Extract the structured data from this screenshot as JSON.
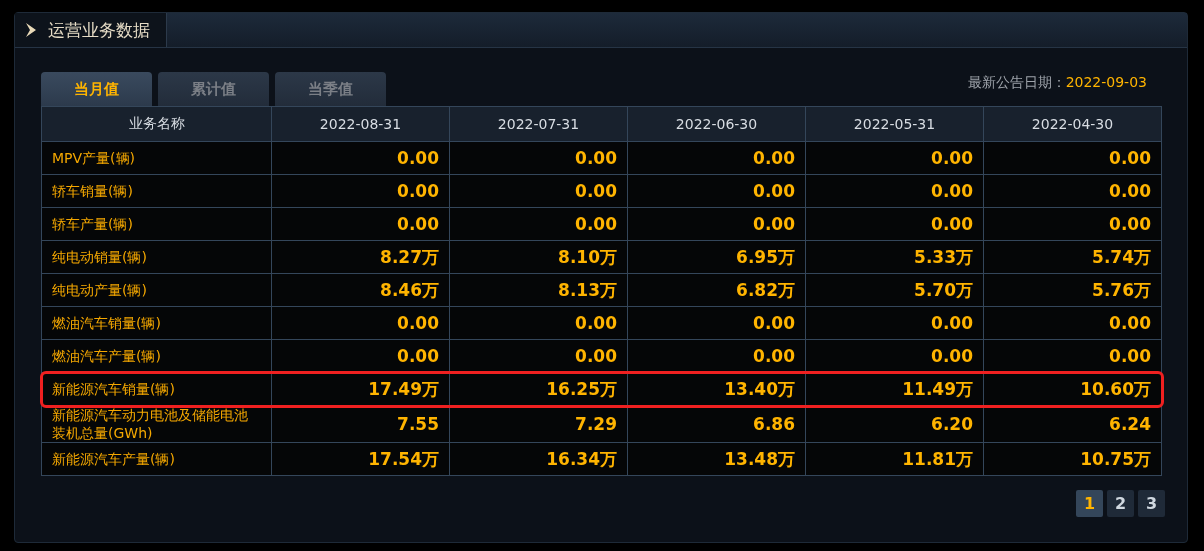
{
  "panel": {
    "title": "运营业务数据"
  },
  "tabs": [
    {
      "label": "当月值",
      "selected": true
    },
    {
      "label": "累计值",
      "selected": false
    },
    {
      "label": "当季值",
      "selected": false
    }
  ],
  "announcement": {
    "label": "最新公告日期：",
    "date": "2022-09-03"
  },
  "table": {
    "columns": [
      "业务名称",
      "2022-08-31",
      "2022-07-31",
      "2022-06-30",
      "2022-05-31",
      "2022-04-30"
    ],
    "rows": [
      {
        "name": "MPV产量(辆)",
        "highlighted": false,
        "values": [
          "0.00",
          "0.00",
          "0.00",
          "0.00",
          "0.00"
        ]
      },
      {
        "name": "轿车销量(辆)",
        "highlighted": false,
        "values": [
          "0.00",
          "0.00",
          "0.00",
          "0.00",
          "0.00"
        ]
      },
      {
        "name": "轿车产量(辆)",
        "highlighted": false,
        "values": [
          "0.00",
          "0.00",
          "0.00",
          "0.00",
          "0.00"
        ]
      },
      {
        "name": "纯电动销量(辆)",
        "highlighted": false,
        "values": [
          "8.27万",
          "8.10万",
          "6.95万",
          "5.33万",
          "5.74万"
        ]
      },
      {
        "name": "纯电动产量(辆)",
        "highlighted": false,
        "values": [
          "8.46万",
          "8.13万",
          "6.82万",
          "5.70万",
          "5.76万"
        ]
      },
      {
        "name": "燃油汽车销量(辆)",
        "highlighted": false,
        "values": [
          "0.00",
          "0.00",
          "0.00",
          "0.00",
          "0.00"
        ]
      },
      {
        "name": "燃油汽车产量(辆)",
        "highlighted": false,
        "values": [
          "0.00",
          "0.00",
          "0.00",
          "0.00",
          "0.00"
        ]
      },
      {
        "name": "新能源汽车销量(辆)",
        "highlighted": true,
        "values": [
          "17.49万",
          "16.25万",
          "13.40万",
          "11.49万",
          "10.60万"
        ]
      },
      {
        "name": "新能源汽车动力电池及储能电池装机总量(GWh)",
        "highlighted": false,
        "values": [
          "7.55",
          "7.29",
          "6.86",
          "6.20",
          "6.24"
        ]
      },
      {
        "name": "新能源汽车产量(辆)",
        "highlighted": false,
        "values": [
          "17.54万",
          "16.34万",
          "13.48万",
          "11.81万",
          "10.75万"
        ]
      }
    ]
  },
  "pagination": [
    {
      "label": "1",
      "selected": true
    },
    {
      "label": "2",
      "selected": false
    },
    {
      "label": "3",
      "selected": false
    }
  ]
}
